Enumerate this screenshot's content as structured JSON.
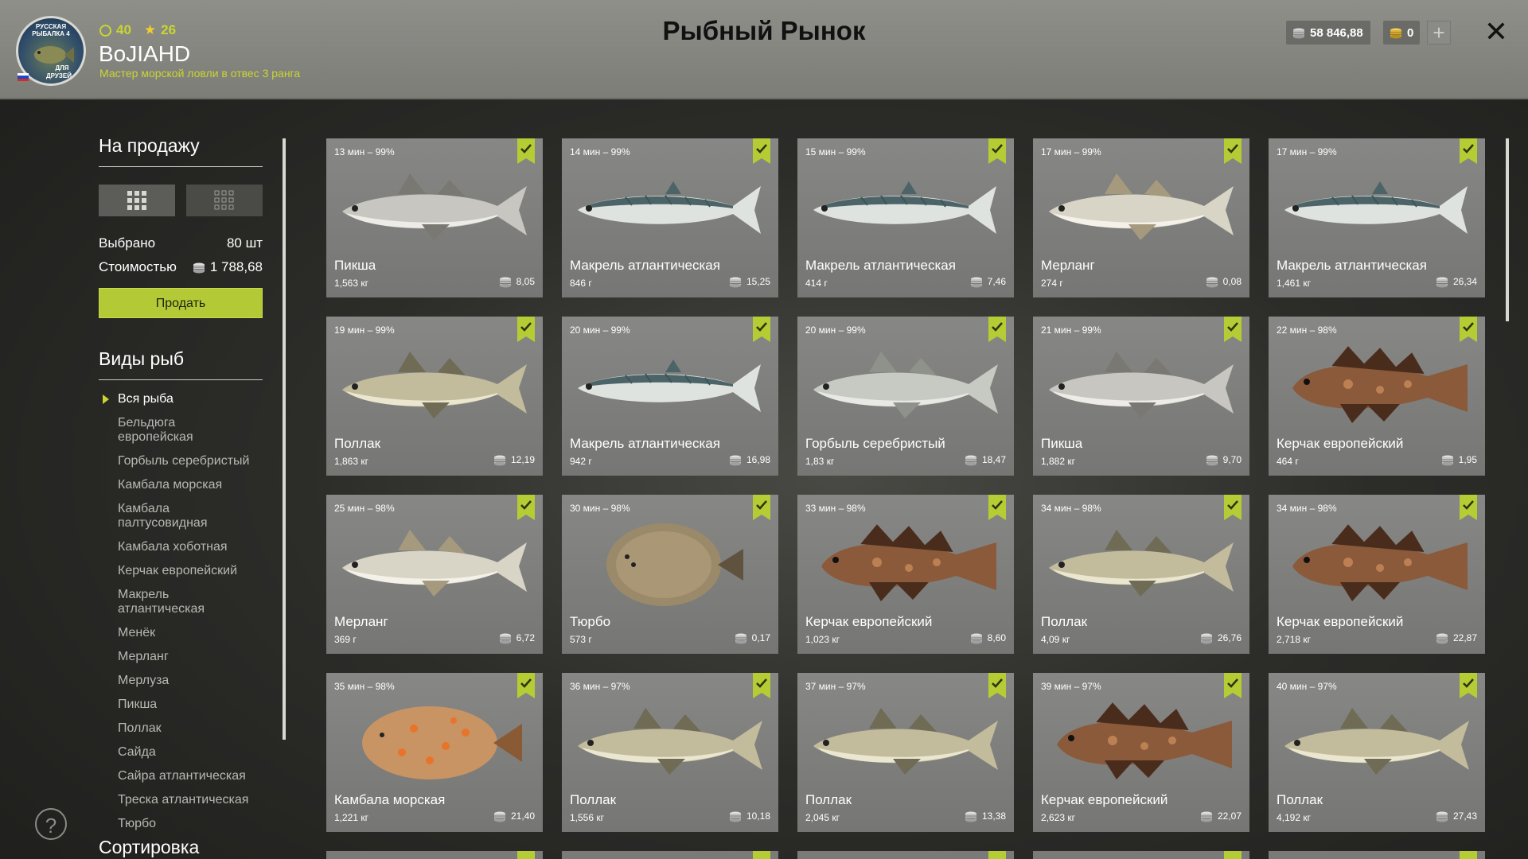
{
  "header": {
    "title": "Рыбный Рынок",
    "level": "40",
    "stars": "26",
    "username": "BoJIAHD",
    "rank": "Мастер морской ловли в отвес 3 ранга",
    "silver": "58 846,88",
    "gold": "0",
    "avatar_text": [
      "РУССКАЯ",
      "РЫБАЛКА 4",
      "ДЛЯ",
      "ДРУЗЕЙ"
    ]
  },
  "sidebar": {
    "for_sale_title": "На продажу",
    "selected_label": "Выбрано",
    "selected_value": "80 шт",
    "cost_label": "Стоимостью",
    "cost_value": "1 788,68",
    "sell_button": "Продать",
    "species_title": "Виды рыб",
    "species": [
      "Вся рыба",
      "Бельдюга европейская",
      "Горбыль серебристый",
      "Камбала морская",
      "Камбала палтусовидная",
      "Камбала хоботная",
      "Керчак европейский",
      "Макрель атлантическая",
      "Менёк",
      "Мерланг",
      "Мерлуза",
      "Пикша",
      "Поллак",
      "Сайда",
      "Сайра атлантическая",
      "Треска атлантическая",
      "Тюрбо"
    ],
    "sort_title": "Сортировка"
  },
  "colors": {
    "accent": "#b6cc34",
    "level": "#c9d530"
  },
  "fish": [
    {
      "time": "13 мин – 99%",
      "name": "Пикша",
      "weight": "1,563 кг",
      "price": "8,05",
      "kind": "haddock"
    },
    {
      "time": "14 мин – 99%",
      "name": "Макрель атлантическая",
      "weight": "846 г",
      "price": "15,25",
      "kind": "mackerel"
    },
    {
      "time": "15 мин – 99%",
      "name": "Макрель атлантическая",
      "weight": "414 г",
      "price": "7,46",
      "kind": "mackerel"
    },
    {
      "time": "17 мин – 99%",
      "name": "Мерланг",
      "weight": "274 г",
      "price": "0,08",
      "kind": "whiting"
    },
    {
      "time": "17 мин – 99%",
      "name": "Макрель атлантическая",
      "weight": "1,461 кг",
      "price": "26,34",
      "kind": "mackerel"
    },
    {
      "time": "19 мин – 99%",
      "name": "Поллак",
      "weight": "1,863 кг",
      "price": "12,19",
      "kind": "pollack"
    },
    {
      "time": "20 мин – 99%",
      "name": "Макрель атлантическая",
      "weight": "942 г",
      "price": "16,98",
      "kind": "mackerel"
    },
    {
      "time": "20 мин – 99%",
      "name": "Горбыль серебристый",
      "weight": "1,83 кг",
      "price": "18,47",
      "kind": "meagre"
    },
    {
      "time": "21 мин – 99%",
      "name": "Пикша",
      "weight": "1,882 кг",
      "price": "9,70",
      "kind": "haddock"
    },
    {
      "time": "22 мин – 98%",
      "name": "Керчак европейский",
      "weight": "464 г",
      "price": "1,95",
      "kind": "sculpin"
    },
    {
      "time": "25 мин – 98%",
      "name": "Мерланг",
      "weight": "369 г",
      "price": "6,72",
      "kind": "whiting"
    },
    {
      "time": "30 мин – 98%",
      "name": "Тюрбо",
      "weight": "573 г",
      "price": "0,17",
      "kind": "turbot"
    },
    {
      "time": "33 мин – 98%",
      "name": "Керчак европейский",
      "weight": "1,023 кг",
      "price": "8,60",
      "kind": "sculpin"
    },
    {
      "time": "34 мин – 98%",
      "name": "Поллак",
      "weight": "4,09 кг",
      "price": "26,76",
      "kind": "pollack"
    },
    {
      "time": "34 мин – 98%",
      "name": "Керчак европейский",
      "weight": "2,718 кг",
      "price": "22,87",
      "kind": "sculpin"
    },
    {
      "time": "35 мин – 98%",
      "name": "Камбала морская",
      "weight": "1,221 кг",
      "price": "21,40",
      "kind": "plaice"
    },
    {
      "time": "36 мин – 97%",
      "name": "Поллак",
      "weight": "1,556 кг",
      "price": "10,18",
      "kind": "pollack"
    },
    {
      "time": "37 мин – 97%",
      "name": "Поллак",
      "weight": "2,045 кг",
      "price": "13,38",
      "kind": "pollack"
    },
    {
      "time": "39 мин – 97%",
      "name": "Керчак европейский",
      "weight": "2,623 кг",
      "price": "22,07",
      "kind": "sculpin"
    },
    {
      "time": "40 мин – 97%",
      "name": "Поллак",
      "weight": "4,192 кг",
      "price": "27,43",
      "kind": "pollack"
    }
  ]
}
